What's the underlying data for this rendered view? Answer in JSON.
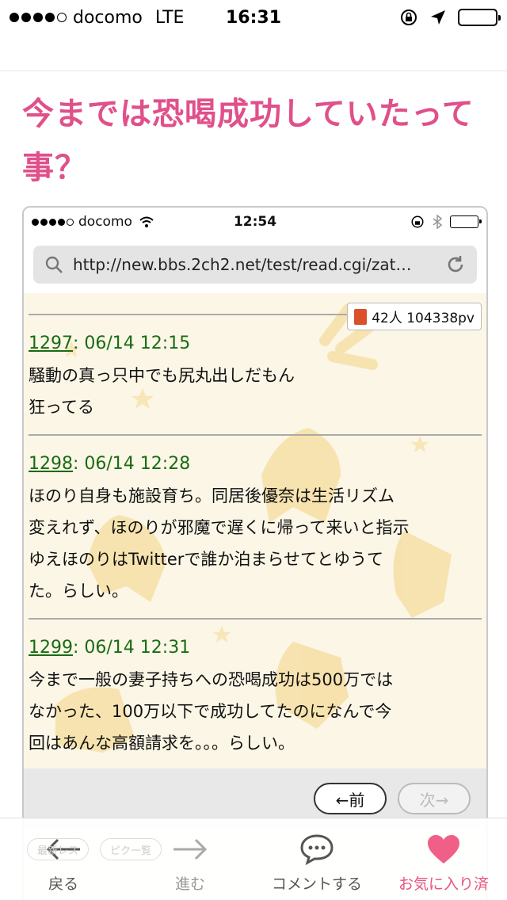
{
  "status_bar": {
    "carrier": "docomo",
    "network": "LTE",
    "time": "16:31"
  },
  "headline": "今までは恐喝成功していたって事？",
  "screenshot": {
    "status_bar": {
      "carrier": "docomo",
      "time": "12:54"
    },
    "url": "http://new.bbs.2ch2.net/test/read.cgi/zat…",
    "page_views": "42人 104338pv",
    "posts": [
      {
        "number": "1297",
        "datetime": ": 06/14 12:15",
        "lines": [
          "騒動の真っ只中でも尻丸出しだもん",
          "狂ってる"
        ]
      },
      {
        "number": "1298",
        "datetime": ": 06/14 12:28",
        "lines": [
          "ほのり自身も施設育ち。同居後優奈は生活リズム",
          "変えれず、ほのりが邪魔で遅くに帰って来いと指示",
          "ゆえほのりはTwitterで誰か泊まらせてとゆうて",
          "た。らしい。"
        ]
      },
      {
        "number": "1299",
        "datetime": ": 06/14 12:31",
        "lines": [
          "今まで一般の妻子持ちへの恐喝成功は500万では",
          "なかった、100万以下で成功してたのになんで今",
          "回はあんな高額請求を。。。らしい。"
        ]
      }
    ],
    "pager": {
      "prev": "←前",
      "next": "次→"
    },
    "ghost_buttons": [
      "最新レス",
      "ピク一覧"
    ]
  },
  "bottom_nav": {
    "back": "戻る",
    "forward": "進む",
    "comment": "コメントする",
    "favorite": "お気に入り済"
  },
  "colors": {
    "headline": "#e0508a",
    "post_header": "#1a6b13",
    "favorite": "#e85480"
  }
}
